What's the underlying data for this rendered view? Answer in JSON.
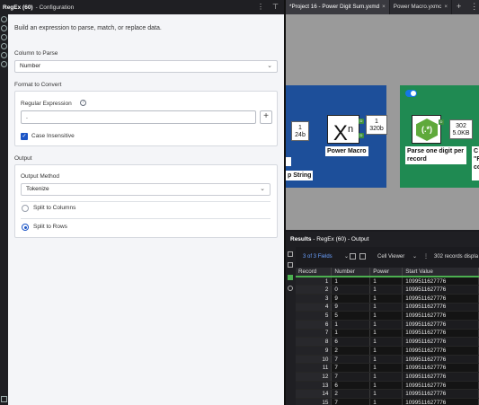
{
  "config": {
    "title_strong": "RegEx (60)",
    "title_rest": "- Configuration",
    "intro": "Build an expression to parse, match, or replace data.",
    "column_to_parse_label": "Column to Parse",
    "column_to_parse_value": "Number",
    "format_section": "Format to Convert",
    "regex_label": "Regular Expression",
    "regex_value": ".",
    "case_insensitive_label": "Case Insensitive",
    "case_insensitive_checked": true,
    "output_section": "Output",
    "output_method_label": "Output Method",
    "output_method_value": "Tokenize",
    "split_columns_label": "Split to Columns",
    "split_rows_label": "Split to Rows",
    "selected_split": "rows"
  },
  "tabs": [
    {
      "label": "*Project 16 - Power Digit Sum.yxmd",
      "active": true
    },
    {
      "label": "Power Macro.yxmc",
      "active": false
    }
  ],
  "canvas": {
    "blue_anchor_left": "1\n24b",
    "blue_anchor_right": "1\n320b",
    "blue_label_fragment": "p String",
    "blue_tool_label": "Power Macro",
    "green_anchor": "302\n5.0KB",
    "green_tool_label": "Parse one digit per record",
    "green_right_fragment": "C\n\"F\nco"
  },
  "results": {
    "header_strong": "Results",
    "header_rest": "- RegEx (60) - Output",
    "fields_text": "3 of 3 Fields",
    "cell_viewer": "Cell Viewer",
    "records_text": "302 records displa",
    "columns": [
      "Record",
      "Number",
      "Power",
      "Start Value"
    ],
    "rows": [
      [
        "1",
        "1",
        "1",
        "1099511627776"
      ],
      [
        "2",
        "0",
        "1",
        "1099511627776"
      ],
      [
        "3",
        "9",
        "1",
        "1099511627776"
      ],
      [
        "4",
        "9",
        "1",
        "1099511627776"
      ],
      [
        "5",
        "5",
        "1",
        "1099511627776"
      ],
      [
        "6",
        "1",
        "1",
        "1099511627776"
      ],
      [
        "7",
        "1",
        "1",
        "1099511627776"
      ],
      [
        "8",
        "6",
        "1",
        "1099511627776"
      ],
      [
        "9",
        "2",
        "1",
        "1099511627776"
      ],
      [
        "10",
        "7",
        "1",
        "1099511627776"
      ],
      [
        "11",
        "7",
        "1",
        "1099511627776"
      ],
      [
        "12",
        "7",
        "1",
        "1099511627776"
      ],
      [
        "13",
        "6",
        "1",
        "1099511627776"
      ],
      [
        "14",
        "2",
        "1",
        "1099511627776"
      ],
      [
        "15",
        "7",
        "1",
        "1099511627776"
      ]
    ]
  }
}
